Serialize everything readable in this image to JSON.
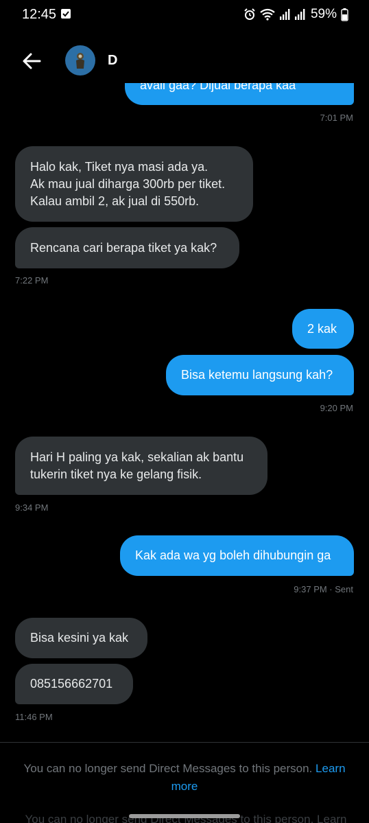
{
  "status": {
    "time": "12:45",
    "battery": "59%",
    "icons": [
      "checkbox-notification-icon",
      "alarm-icon",
      "wifi-icon",
      "signal-icon",
      "signal-icon",
      "battery-icon"
    ]
  },
  "header": {
    "contact_name": "D",
    "back_icon": "arrow-left-icon"
  },
  "messages": [
    {
      "from": "me",
      "lines": [
        "avail gaa? Dijual berapa kaa"
      ]
    },
    {
      "time": "7:01 PM"
    },
    {
      "from": "them",
      "lines": [
        "Halo kak, Tiket nya masi ada ya.",
        "Ak mau jual diharga 300rb per tiket.",
        "Kalau ambil 2, ak jual di 550rb."
      ]
    },
    {
      "from": "them",
      "lines": [
        "Rencana cari berapa tiket ya kak?"
      ]
    },
    {
      "time": "7:22 PM"
    },
    {
      "from": "me",
      "lines": [
        "2 kak"
      ]
    },
    {
      "from": "me",
      "lines": [
        "Bisa ketemu langsung kah?"
      ]
    },
    {
      "time": "9:20 PM"
    },
    {
      "from": "them",
      "lines": [
        "Hari H paling ya kak, sekalian ak bantu",
        "tukerin tiket nya ke gelang fisik."
      ]
    },
    {
      "time": "9:34 PM"
    },
    {
      "from": "me",
      "lines": [
        "Kak ada wa yg boleh dihubungin ga"
      ]
    },
    {
      "time": "9:37 PM · Sent"
    },
    {
      "from": "them",
      "lines": [
        "Bisa kesini ya kak"
      ]
    },
    {
      "from": "them",
      "lines": [
        "085156662701"
      ]
    },
    {
      "time": "11:46 PM"
    }
  ],
  "footer": {
    "notice": "You can no longer send Direct Messages to this person.",
    "learn_more": "Learn more",
    "ghost": "You can no longer send Direct Messages to this person. Learn"
  },
  "colors": {
    "background": "#000000",
    "incoming_bubble": "#2f3336",
    "outgoing_bubble": "#1d9bf0",
    "timestamp": "#71767b",
    "link": "#1d9bf0"
  }
}
